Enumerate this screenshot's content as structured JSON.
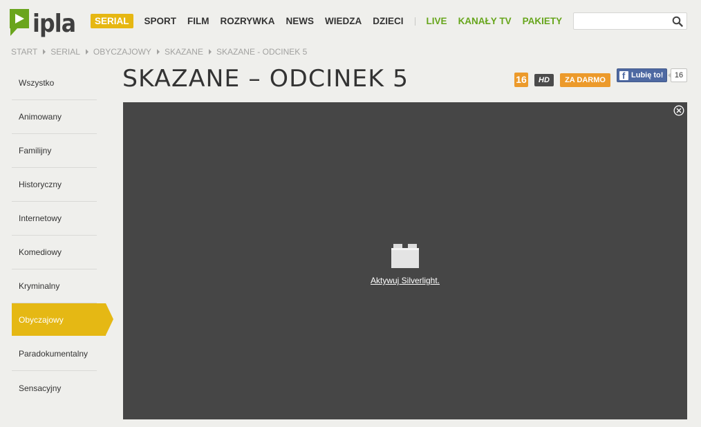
{
  "header": {
    "logo_text": "ipla",
    "nav": [
      {
        "label": "SERIAL",
        "active": true,
        "color": "#e6b712"
      },
      {
        "label": "SPORT"
      },
      {
        "label": "FILM"
      },
      {
        "label": "ROZRYWKA"
      },
      {
        "label": "NEWS"
      },
      {
        "label": "WIEDZA"
      },
      {
        "label": "DZIECI"
      },
      {
        "label": "LIVE",
        "color": "#66a51b"
      },
      {
        "label": "KANAŁY TV",
        "color": "#66a51b"
      },
      {
        "label": "PAKIETY",
        "color": "#66a51b"
      }
    ],
    "search": {
      "value": "",
      "placeholder": ""
    }
  },
  "breadcrumb": [
    "START",
    "SERIAL",
    "OBYCZAJOWY",
    "SKAZANE",
    "SKAZANE - ODCINEK 5"
  ],
  "sidebar": {
    "items": [
      {
        "label": "Wszystko"
      },
      {
        "label": "Animowany"
      },
      {
        "label": "Familijny"
      },
      {
        "label": "Historyczny"
      },
      {
        "label": "Internetowy"
      },
      {
        "label": "Komediowy"
      },
      {
        "label": "Kryminalny"
      },
      {
        "label": "Obyczajowy",
        "active": true
      },
      {
        "label": "Paradokumentalny"
      },
      {
        "label": "Sensacyjny"
      }
    ]
  },
  "main": {
    "title": "SKAZANE – ODCINEK 5",
    "badges": {
      "age": "16",
      "hd": "HD",
      "free": "ZA DARMO"
    },
    "facebook": {
      "label": "Lubię to!",
      "count": "16"
    },
    "player": {
      "activate_label": "Aktywuj Silverlight."
    }
  },
  "colors": {
    "accent": "#e5b814",
    "green": "#66a51b",
    "orange": "#ec9a2b",
    "player_bg": "#464646",
    "fb": "#4e69a2"
  }
}
